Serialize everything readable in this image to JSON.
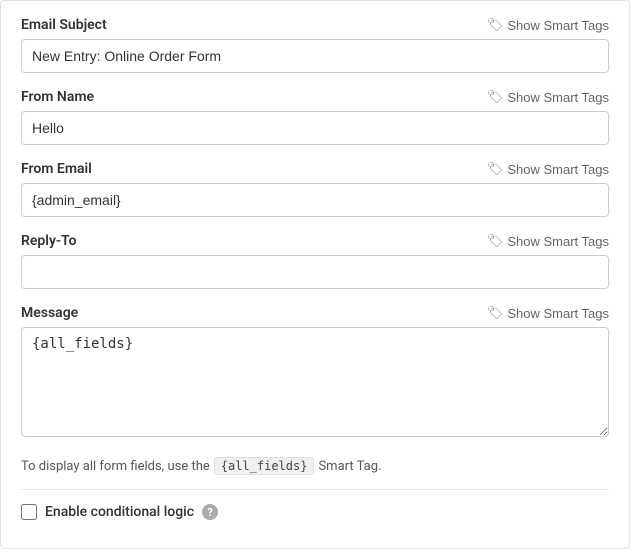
{
  "fields": {
    "email_subject": {
      "label": "Email Subject",
      "smart_tags_label": "Show Smart Tags",
      "value": "New Entry: Online Order Form",
      "placeholder": ""
    },
    "from_name": {
      "label": "From Name",
      "smart_tags_label": "Show Smart Tags",
      "value": "Hello",
      "placeholder": ""
    },
    "from_email": {
      "label": "From Email",
      "smart_tags_label": "Show Smart Tags",
      "value": "{admin_email}",
      "placeholder": ""
    },
    "reply_to": {
      "label": "Reply-To",
      "smart_tags_label": "Show Smart Tags",
      "value": "",
      "placeholder": ""
    },
    "message": {
      "label": "Message",
      "smart_tags_label": "Show Smart Tags",
      "value": "{all_fields}",
      "placeholder": ""
    }
  },
  "hint": {
    "prefix": "To display all form fields, use the",
    "code": "{all_fields}",
    "suffix": "Smart Tag."
  },
  "conditional_logic": {
    "label": "Enable conditional logic",
    "checked": false
  },
  "icons": {
    "tag": "🏷",
    "help": "?"
  }
}
